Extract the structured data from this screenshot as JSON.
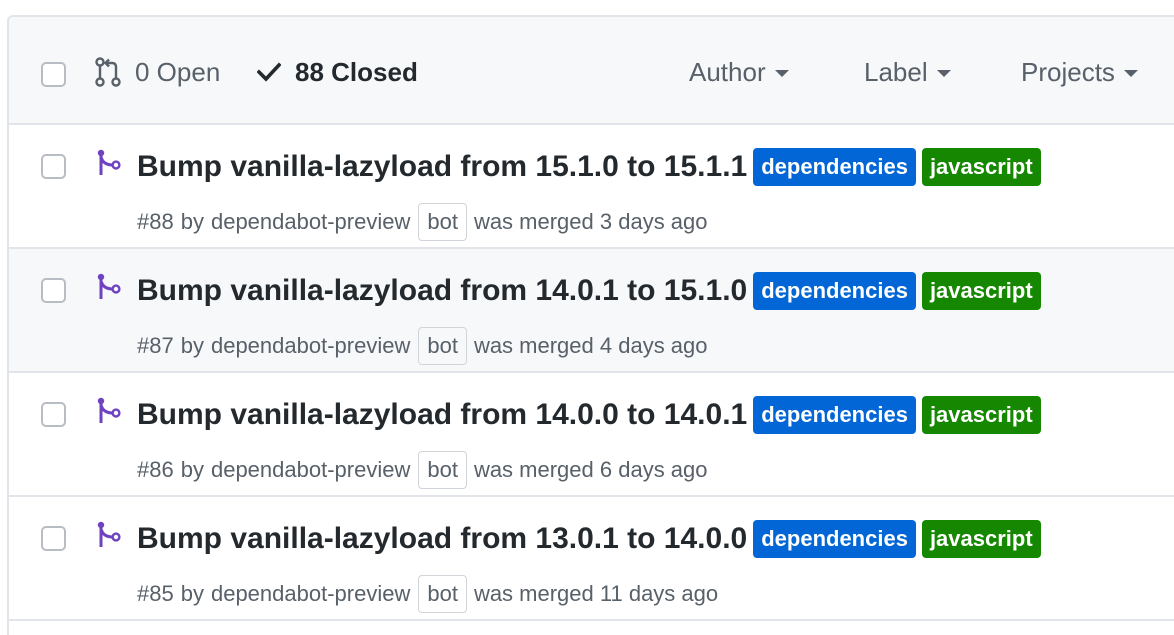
{
  "header": {
    "open_label": "0 Open",
    "closed_label": "88 Closed",
    "filters": [
      {
        "label": "Author"
      },
      {
        "label": "Label"
      },
      {
        "label": "Projects"
      }
    ]
  },
  "colors": {
    "dependencies": "#0366d6",
    "javascript": "#168700",
    "merged_icon": "#6f42c1"
  },
  "pull_requests": [
    {
      "title": "Bump vanilla-lazyload from 15.1.0 to 15.1.1",
      "labels": [
        "dependencies",
        "javascript"
      ],
      "number": "#88",
      "by": "by",
      "author": "dependabot-preview",
      "badge": "bot",
      "status": "was merged 3 days ago"
    },
    {
      "title": "Bump vanilla-lazyload from 14.0.1 to 15.1.0",
      "labels": [
        "dependencies",
        "javascript"
      ],
      "number": "#87",
      "by": "by",
      "author": "dependabot-preview",
      "badge": "bot",
      "status": "was merged 4 days ago"
    },
    {
      "title": "Bump vanilla-lazyload from 14.0.0 to 14.0.1",
      "labels": [
        "dependencies",
        "javascript"
      ],
      "number": "#86",
      "by": "by",
      "author": "dependabot-preview",
      "badge": "bot",
      "status": "was merged 6 days ago"
    },
    {
      "title": "Bump vanilla-lazyload from 13.0.1 to 14.0.0",
      "labels": [
        "dependencies",
        "javascript"
      ],
      "number": "#85",
      "by": "by",
      "author": "dependabot-preview",
      "badge": "bot",
      "status": "was merged 11 days ago"
    }
  ]
}
